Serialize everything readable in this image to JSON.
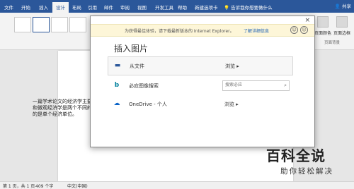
{
  "ribbon": {
    "tabs": [
      "文件",
      "开始",
      "插入",
      "设计",
      "布局",
      "引用",
      "邮件",
      "审阅",
      "视图",
      "开发工具",
      "帮助",
      "新建选项卡"
    ],
    "active_tab": "设计",
    "tell_me": "告诉我你想要做什么",
    "share": "共享",
    "buttons": [
      "页面颜色",
      "页面边框"
    ],
    "group_label": "页面背景"
  },
  "dialog": {
    "close": "×",
    "ie_message": "为获得最佳体验，请下载最新版本的 Internet Explorer。",
    "ie_link": "了解详细信息",
    "title": "插入图片",
    "rows": [
      {
        "label": "从文件",
        "action": "浏览 ▸"
      },
      {
        "label": "必应图像搜索",
        "search_placeholder": "搜索必应"
      },
      {
        "label": "OneDrive - 个人",
        "action": "浏览 ▸"
      }
    ]
  },
  "document": {
    "text": "一篇学术论文的经济学主要可以分为两类，以前被称为宏观经济学与微观经济学。宏观经济学和微观经济学是两个不同的经济领域，简单的宏观经济学研究的是整个经济，微观经济学研究的是单个经济单位。"
  },
  "status": {
    "page": "第 1 页，共 1 页",
    "words": "409 个字",
    "language": "中文(中国)"
  },
  "watermark": {
    "title": "百科全说",
    "subtitle": "助你轻松解决"
  },
  "icons": {
    "folder": "folder-icon",
    "bing": "bing-icon",
    "onedrive": "onedrive-icon"
  }
}
